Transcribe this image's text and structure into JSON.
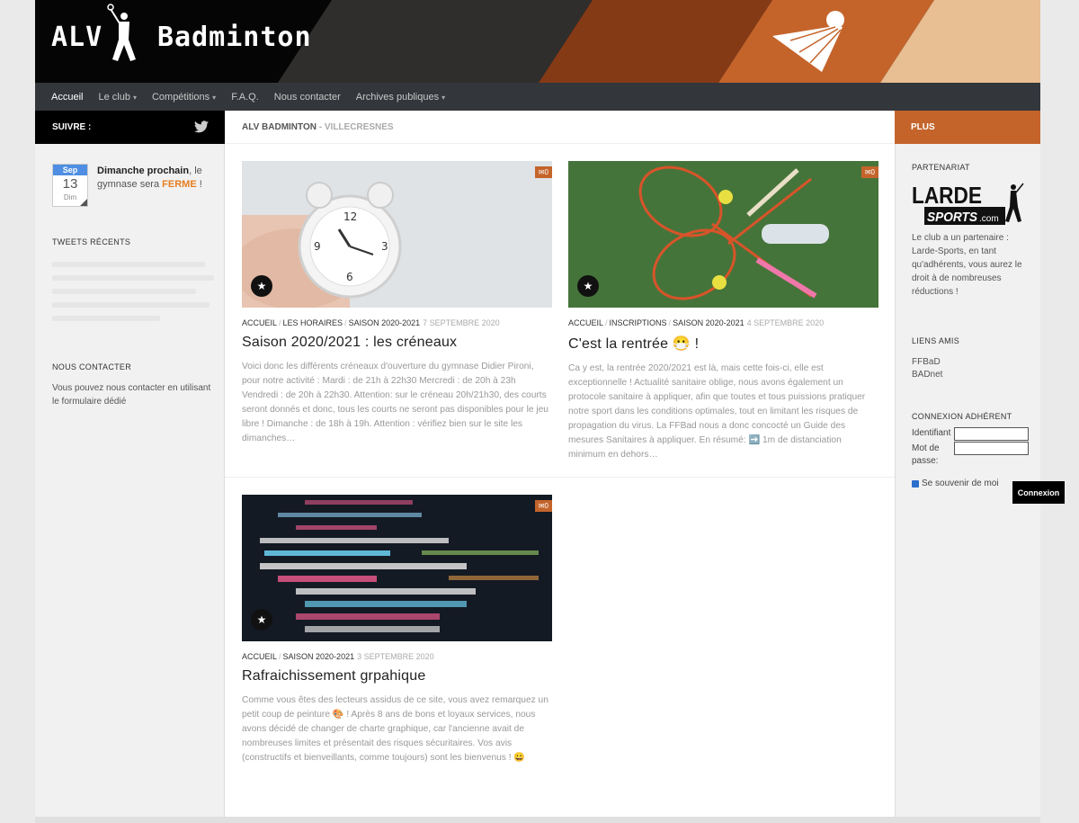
{
  "header": {
    "title_part1": "ALV",
    "title_part2": "Badminton",
    "colors": {
      "band1": "#2f2e2d",
      "band2": "#853a16",
      "band3": "#c4642b",
      "band4": "#e8be93"
    }
  },
  "nav": {
    "items": [
      {
        "label": "Accueil",
        "active": true,
        "dropdown": false
      },
      {
        "label": "Le club",
        "dropdown": true
      },
      {
        "label": "Compétitions",
        "dropdown": true
      },
      {
        "label": "F.A.Q.",
        "dropdown": false
      },
      {
        "label": "Nous contacter",
        "dropdown": false
      },
      {
        "label": "Archives publiques",
        "dropdown": true
      }
    ],
    "caret": "▾"
  },
  "subbar": {
    "follow_label": "SUIVRE :",
    "follow_icon": "twitter-icon",
    "breadcrumb_site": "ALV BADMINTON",
    "breadcrumb_sep": "-",
    "breadcrumb_location": "VILLECRESNES",
    "plus_label": "PLUS",
    "accent": "#c4642b"
  },
  "left": {
    "calendar": {
      "month": "Sep",
      "day": "13",
      "weekday": "Dim"
    },
    "sunday_bold": "Dimanche prochain",
    "sunday_text1": ", le gymnase sera ",
    "sunday_highlight": "FERME",
    "sunday_text2": " !",
    "tweets_title": "TWEETS RÉCENTS",
    "contact_title": "NOUS CONTACTER",
    "contact_text": "Vous pouvez nous contacter en utilisant le formulaire dédié"
  },
  "posts": [
    {
      "image": "alarm-clock-photo",
      "comments": "0",
      "categories": [
        "ACCUEIL",
        "LES HORAIRES",
        "SAISON 2020-2021"
      ],
      "date": "7 SEPTEMBRE 2020",
      "title": "Saison 2020/2021 : les créneaux",
      "excerpt": "Voici donc les différents créneaux d'ouverture du gymnase Didier Pironi, pour notre activité : Mardi : de 21h à 22h30 Mercredi : de 20h à 23h Vendredi : de 20h à 22h30. Attention: sur le créneau 20h/21h30, des courts seront donnés et donc, tous les courts ne seront pas disponibles pour le jeu libre ! Dimanche : de 18h à 19h. Attention : vérifiez bien sur le site les dimanches…"
    },
    {
      "image": "badminton-rackets-photo",
      "comments": "0",
      "categories": [
        "ACCUEIL",
        "INSCRIPTIONS",
        "SAISON 2020-2021"
      ],
      "date": "4 SEPTEMBRE 2020",
      "title": "C'est la rentrée 😷 !",
      "excerpt": "Ca y est, la rentrée 2020/2021 est là, mais cette fois-ci, elle est exceptionnelle ! Actualité sanitaire oblige, nous avons également un protocole sanitaire à appliquer, afin que toutes et tous puissions pratiquer notre sport dans les conditions optimales, tout en limitant les risques de propagation du virus. La FFBad nous a donc concocté un Guide des mesures Sanitaires à appliquer. En résumé: ➡️ 1m de distanciation minimum en dehors…"
    },
    {
      "image": "source-code-photo",
      "comments": "0",
      "categories": [
        "ACCUEIL",
        "SAISON 2020-2021"
      ],
      "date": "3 SEPTEMBRE 2020",
      "title": "Rafraichissement grpahique",
      "excerpt": "Comme vous êtes des lecteurs assidus de ce site, vous avez remarquez un petit coup de peinture 🎨 ! Après 8 ans de bons et loyaux services, nous avons décidé de changer de charte graphique, car l'ancienne avait de nombreuses limites et présentait des risques sécuritaires. Vos avis (constructifs et bienveillants, comme toujours) sont les bienvenus ! 😀"
    }
  ],
  "right": {
    "partner_title": "PARTENARIAT",
    "logo_line1": "LARDE",
    "logo_line2": "SPORTS",
    "logo_suffix": ".com",
    "partner_text": "Le club a un partenaire : Larde-Sports, en tant qu'adhérents, vous aurez le droit à de nombreuses réductions !",
    "friends_title": "LIENS AMIS",
    "friends": [
      "FFBaD",
      "BADnet"
    ],
    "login_title": "CONNEXION ADHÉRENT",
    "login_id_label": "Identifiant",
    "login_pw_label1": "Mot de",
    "login_pw_label2": "passe:",
    "remember_label": "Se souvenir de moi",
    "login_button": "Connexion"
  }
}
